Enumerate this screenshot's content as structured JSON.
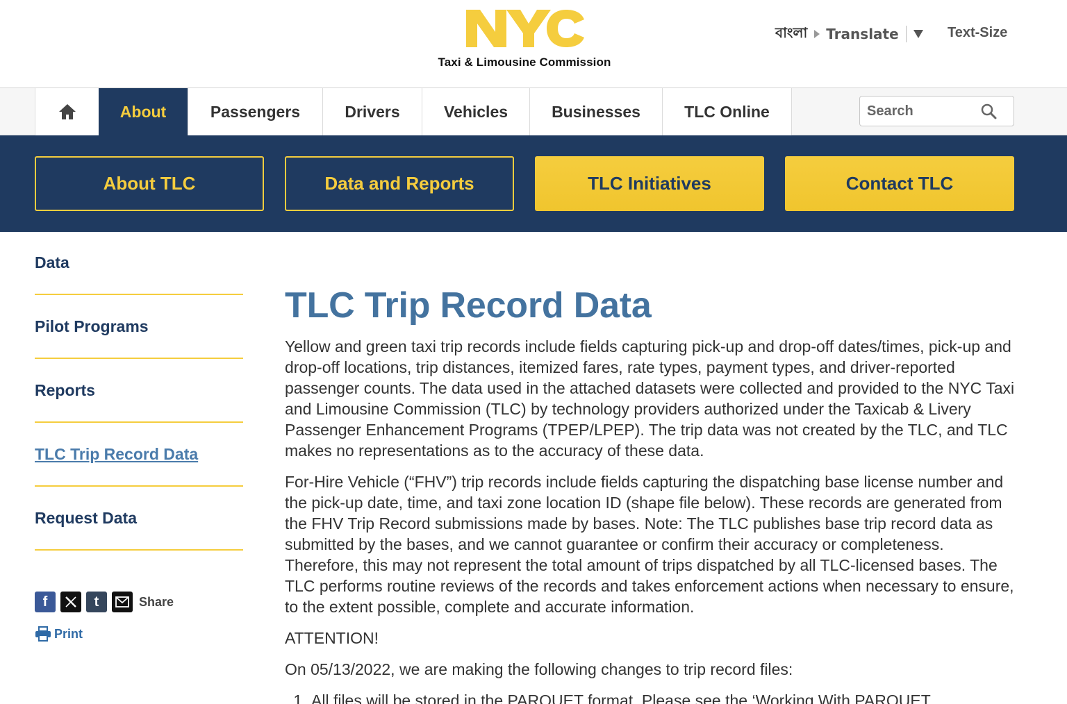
{
  "header": {
    "logo_text": "NYC",
    "logo_subtitle": "Taxi & Limousine Commission",
    "language_label": "বাংলা",
    "translate_label": "Translate",
    "text_size_label": "Text-Size"
  },
  "nav": {
    "items": [
      {
        "label": "About"
      },
      {
        "label": "Passengers"
      },
      {
        "label": "Drivers"
      },
      {
        "label": "Vehicles"
      },
      {
        "label": "Businesses"
      },
      {
        "label": "TLC Online"
      }
    ],
    "active": "About",
    "search_placeholder": "Search"
  },
  "subnav": {
    "buttons": [
      {
        "label": "About TLC"
      },
      {
        "label": "Data and Reports"
      },
      {
        "label": "TLC Initiatives"
      },
      {
        "label": "Contact TLC"
      }
    ]
  },
  "sidebar": {
    "items": [
      {
        "label": "Data"
      },
      {
        "label": "Pilot Programs"
      },
      {
        "label": "Reports"
      },
      {
        "label": "TLC Trip Record Data"
      },
      {
        "label": "Request Data"
      }
    ],
    "current": "TLC Trip Record Data",
    "share_label": "Share",
    "print_label": "Print"
  },
  "content": {
    "title": "TLC Trip Record Data",
    "paragraph1": "Yellow and green taxi trip records include fields capturing pick-up and drop-off dates/times, pick-up and drop-off locations, trip distances, itemized fares, rate types, payment types, and driver-reported passenger counts. The data used in the attached datasets were collected and provided to the NYC Taxi and Limousine Commission (TLC) by technology providers authorized under the Taxicab & Livery Passenger Enhancement Programs (TPEP/LPEP). The trip data was not created by the TLC, and TLC makes no representations as to the accuracy of these data.",
    "paragraph2": "For-Hire Vehicle (“FHV”) trip records include fields capturing the dispatching base license number and the pick-up date, time, and taxi zone location ID (shape file below). These records are generated from the FHV Trip Record submissions made by bases. Note: The TLC publishes base trip record data as submitted by the bases, and we cannot guarantee or confirm their accuracy or completeness. Therefore, this may not represent the total amount of trips dispatched by all TLC-licensed bases. The TLC performs routine reviews of the records and takes enforcement actions when necessary to ensure, to the extent possible, complete and accurate information.",
    "attention": "ATTENTION!",
    "changes_intro": "On 05/13/2022, we are making the following changes to trip record files:",
    "list_items": [
      "All files will be stored in the PARQUET format. Please see the ‘Working With PARQUET"
    ]
  },
  "colors": {
    "navy": "#1f3a60",
    "yellow": "#f5cd3e",
    "title_blue": "#44739f",
    "link_blue": "#4a7bab"
  }
}
